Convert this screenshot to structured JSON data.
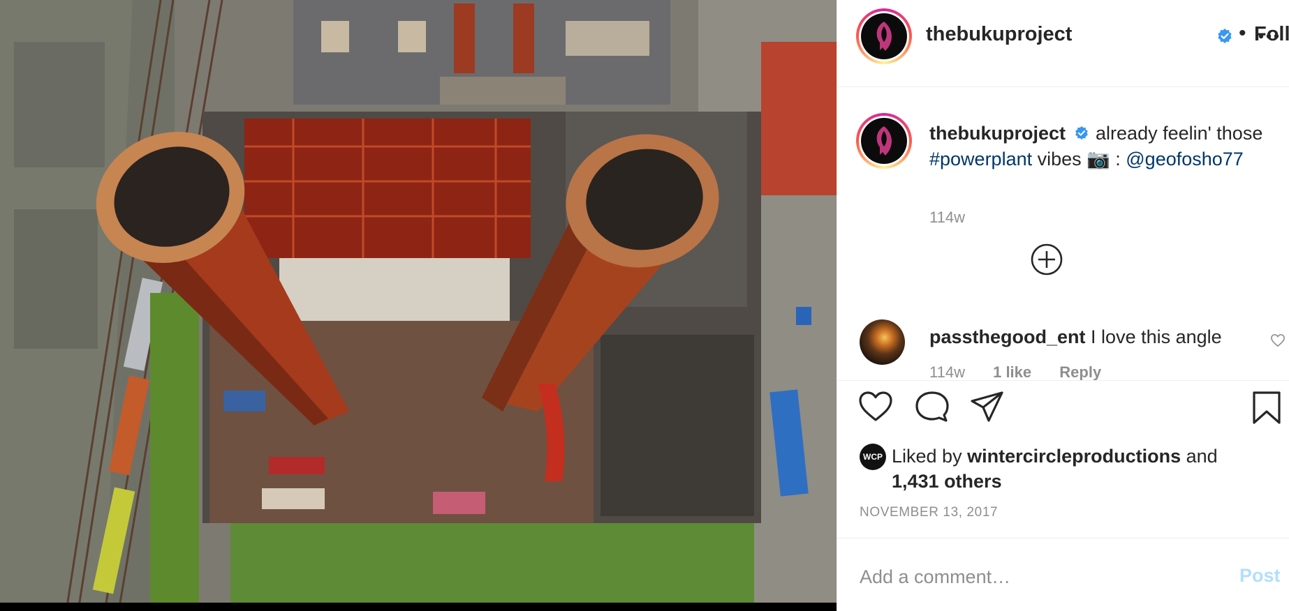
{
  "post_header": {
    "username": "thebukuproject",
    "separator": "•",
    "follow_status": "Following"
  },
  "caption": {
    "username": "thebukuproject",
    "text_part1": " already feelin' those ",
    "hashtag": "#powerplant",
    "text_part2": " vibes 📷 : ",
    "mention": "@geofosho77",
    "timestamp": "114w"
  },
  "comments": [
    {
      "username": "passthegood_ent",
      "text": "I love this angle",
      "timestamp": "114w",
      "likes": "1 like",
      "reply_label": "Reply"
    }
  ],
  "likes": {
    "prefix": "Liked by ",
    "top_liker": "wintercircleproductions",
    "suffix": " and",
    "others": "1,431 others",
    "liker_avatar_text": "WCP"
  },
  "date": "NOVEMBER 13, 2017",
  "comment_input": {
    "placeholder": "Add a comment…",
    "post_label": "Post"
  },
  "colors": {
    "verified": "#3897f0",
    "link": "#00376b",
    "muted": "#8e8e8e",
    "post_disabled": "#b2dffc"
  }
}
